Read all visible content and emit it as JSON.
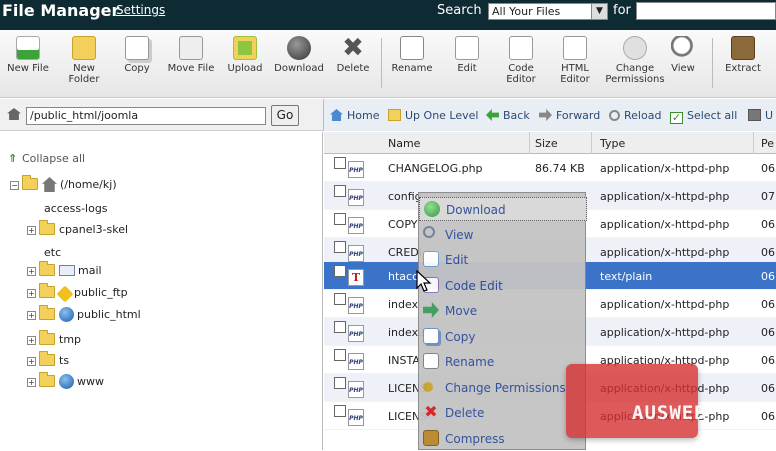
{
  "titlebar": {
    "title": "File Manager",
    "settings": "Settings",
    "search_label": "Search",
    "search_scope": "All Your Files",
    "for_label": "for"
  },
  "toolbar": [
    {
      "line1": "New File",
      "line2": ""
    },
    {
      "line1": "New",
      "line2": "Folder"
    },
    {
      "line1": "Copy",
      "line2": ""
    },
    {
      "line1": "Move File",
      "line2": ""
    },
    {
      "line1": "Upload",
      "line2": ""
    },
    {
      "line1": "Download",
      "line2": ""
    },
    {
      "line1": "Delete",
      "line2": ""
    },
    {
      "line1": "Rename",
      "line2": ""
    },
    {
      "line1": "Edit",
      "line2": ""
    },
    {
      "line1": "Code",
      "line2": "Editor"
    },
    {
      "line1": "HTML",
      "line2": "Editor"
    },
    {
      "line1": "Change",
      "line2": "Permissions"
    },
    {
      "line1": "View",
      "line2": ""
    },
    {
      "line1": "Extract",
      "line2": ""
    }
  ],
  "address": {
    "path": "/public_html/joomla",
    "go": "Go"
  },
  "nav": {
    "home": "Home",
    "up": "Up One Level",
    "back": "Back",
    "forward": "Forward",
    "reload": "Reload",
    "select_all": "Select all",
    "unselect": "U"
  },
  "tree": {
    "collapse": "Collapse all",
    "root": "(/home/kj)",
    "items": [
      "access-logs",
      "cpanel3-skel",
      "etc",
      "mail",
      "public_ftp",
      "public_html",
      "tmp",
      "ts",
      "www"
    ]
  },
  "table": {
    "headers": [
      "Name",
      "Size",
      "Type",
      "Pe"
    ],
    "rows": [
      {
        "name": "CHANGELOG.php",
        "size": "86.74 KB",
        "type": "application/x-httpd-php",
        "perm": "06"
      },
      {
        "name": "config",
        "size": "",
        "type": "application/x-httpd-php",
        "perm": "07"
      },
      {
        "name": "COPY",
        "size": "",
        "type": "application/x-httpd-php",
        "perm": "06"
      },
      {
        "name": "CREDI",
        "size": "",
        "type": "application/x-httpd-php",
        "perm": "06"
      },
      {
        "name": "htacc",
        "size": "",
        "type": "text/plain",
        "perm": "06"
      },
      {
        "name": "index.",
        "size": "",
        "type": "application/x-httpd-php",
        "perm": "06"
      },
      {
        "name": "index2",
        "size": "",
        "type": "application/x-httpd-php",
        "perm": "06"
      },
      {
        "name": "INSTA",
        "size": "",
        "type": "application/x-httpd-php",
        "perm": "06"
      },
      {
        "name": "LICENS",
        "size": "",
        "type": "application/x-httpd-php",
        "perm": "06"
      },
      {
        "name": "LICENS",
        "size": "",
        "type": "application/x-httpd-php",
        "perm": "06"
      }
    ]
  },
  "context_menu": [
    {
      "label": "Download",
      "icon": "download-icon",
      "color": "#2f8f3a"
    },
    {
      "label": "View",
      "icon": "magnifier-icon",
      "color": "#6d7d93"
    },
    {
      "label": "Edit",
      "icon": "edit-icon",
      "color": "#6aa0c8"
    },
    {
      "label": "Code Edit",
      "icon": "code-icon",
      "color": "#8b6fb8"
    },
    {
      "label": "Move",
      "icon": "move-icon",
      "color": "#3a9a5a"
    },
    {
      "label": "Copy",
      "icon": "copy-icon",
      "color": "#6a8cc0"
    },
    {
      "label": "Rename",
      "icon": "rename-icon",
      "color": "#7d7d7d"
    },
    {
      "label": "Change Permissions",
      "icon": "key-icon",
      "color": "#c9a22a"
    },
    {
      "label": "Delete",
      "icon": "delete-icon",
      "color": "#d42020"
    },
    {
      "label": "Compress",
      "icon": "compress-icon",
      "color": "#b8862a"
    }
  ],
  "watermark": "AUSWEB"
}
